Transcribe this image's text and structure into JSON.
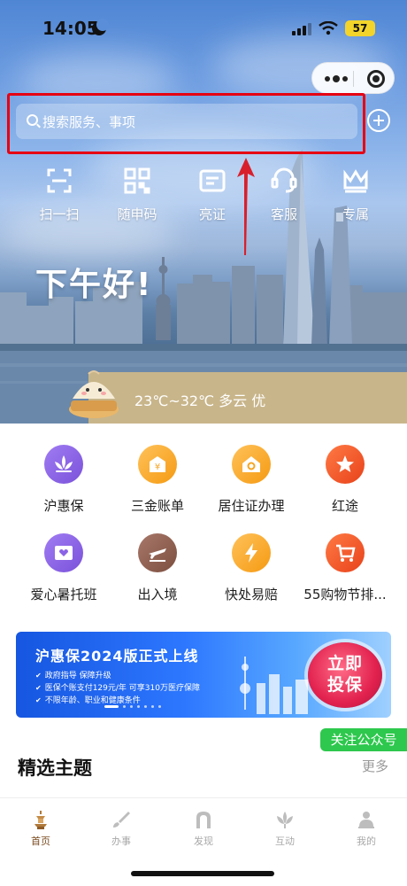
{
  "status_bar": {
    "time": "14:05",
    "battery": "57"
  },
  "search": {
    "placeholder": "搜索服务、事项"
  },
  "quick_actions": [
    {
      "label": "扫一扫",
      "icon": "scan-icon"
    },
    {
      "label": "随申码",
      "icon": "qr-code-icon"
    },
    {
      "label": "亮证",
      "icon": "id-card-icon"
    },
    {
      "label": "客服",
      "icon": "customer-service-icon"
    },
    {
      "label": "专属",
      "icon": "crown-icon"
    }
  ],
  "greeting": "下午好!",
  "weather": {
    "text": "23℃~32℃ 多云 优"
  },
  "services": [
    {
      "label": "沪惠保",
      "icon": "lotus-icon",
      "color": "#8a63e6"
    },
    {
      "label": "三金账单",
      "icon": "money-bag-icon",
      "color": "#f5a623"
    },
    {
      "label": "居住证办理",
      "icon": "house-icon",
      "color": "#f5a623"
    },
    {
      "label": "红途",
      "icon": "star-icon",
      "color": "#ef4a1e"
    },
    {
      "label": "爱心暑托班",
      "icon": "heart-card-icon",
      "color": "#8a63e6"
    },
    {
      "label": "出入境",
      "icon": "airplane-icon",
      "color": "#8a5a44"
    },
    {
      "label": "快处易赔",
      "icon": "lightning-icon",
      "color": "#f5a623"
    },
    {
      "label": "55购物节排...",
      "icon": "shopping-cart-icon",
      "color": "#ef4a1e"
    }
  ],
  "banner": {
    "title": "沪惠保2024版正式上线",
    "lines": [
      "政府指导 保障升级",
      "医保个账支付129元/年 可享310万医疗保障",
      "不限年龄、职业和健康条件"
    ],
    "cta_line1": "立即",
    "cta_line2": "投保"
  },
  "follow_badge": "关注公众号",
  "section": {
    "title": "精选主题",
    "more": "更多"
  },
  "tabs": [
    {
      "label": "首页",
      "icon": "pagoda-icon"
    },
    {
      "label": "办事",
      "icon": "brush-icon"
    },
    {
      "label": "发现",
      "icon": "arch-icon"
    },
    {
      "label": "互动",
      "icon": "magnolia-icon"
    },
    {
      "label": "我的",
      "icon": "person-icon"
    }
  ],
  "colors": {
    "highlight": "#e60012",
    "follow_green": "#2dc84d",
    "tab_active": "#7a4b1f"
  }
}
